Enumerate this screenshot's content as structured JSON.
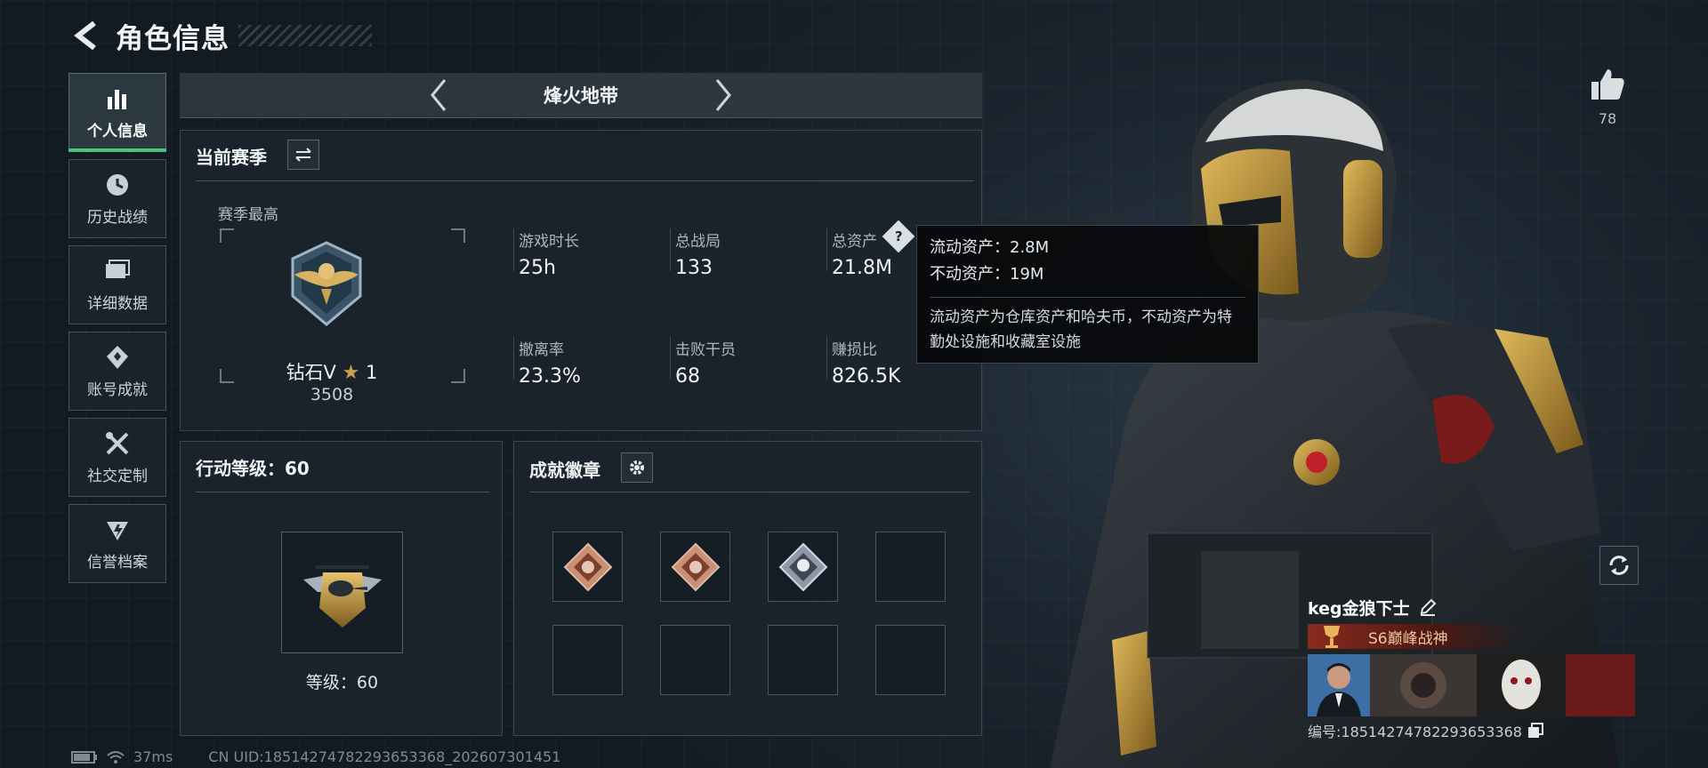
{
  "header": {
    "title": "角色信息"
  },
  "nav": {
    "items": [
      {
        "label": "个人信息",
        "icon": "bar-chart-icon",
        "active": true
      },
      {
        "label": "历史战绩",
        "icon": "history-icon",
        "active": false
      },
      {
        "label": "详细数据",
        "icon": "folder-icon",
        "active": false
      },
      {
        "label": "账号成就",
        "icon": "achievement-icon",
        "active": false
      },
      {
        "label": "社交定制",
        "icon": "tools-icon",
        "active": false
      },
      {
        "label": "信誉档案",
        "icon": "credit-icon",
        "active": false
      }
    ]
  },
  "mode": {
    "title": "烽火地带"
  },
  "season": {
    "title": "当前赛季",
    "best_label": "赛季最高",
    "rank_name": "钻石V",
    "rank_stars": "1",
    "rank_score": "3508",
    "stats": [
      {
        "label": "游戏时长",
        "value": "25h"
      },
      {
        "label": "总战局",
        "value": "133"
      },
      {
        "label": "总资产",
        "value": "21.8M"
      },
      {
        "label": "撤离率",
        "value": "23.3%"
      },
      {
        "label": "击败干员",
        "value": "68"
      },
      {
        "label": "赚损比",
        "value": "826.5K"
      }
    ]
  },
  "tooltip": {
    "liquid": "流动资产：2.8M",
    "fixed": "不动资产：19M",
    "desc": "流动资产为仓库资产和哈夫币，不动资产为特勤处设施和收藏室设施"
  },
  "action_level": {
    "title": "行动等级：60",
    "level_text": "等级：60"
  },
  "achievements": {
    "title": "成就徽章"
  },
  "like": {
    "count": "78"
  },
  "player": {
    "name": "keg金狼下士",
    "title": "S6巅峰战神",
    "uid_label": "编号:18514274782293653368"
  },
  "status": {
    "ping": "37ms",
    "uid": "CN UID:18514274782293653368_202607301451"
  },
  "colors": {
    "accent_green": "#4bc17e",
    "gold": "#c9a24a"
  }
}
